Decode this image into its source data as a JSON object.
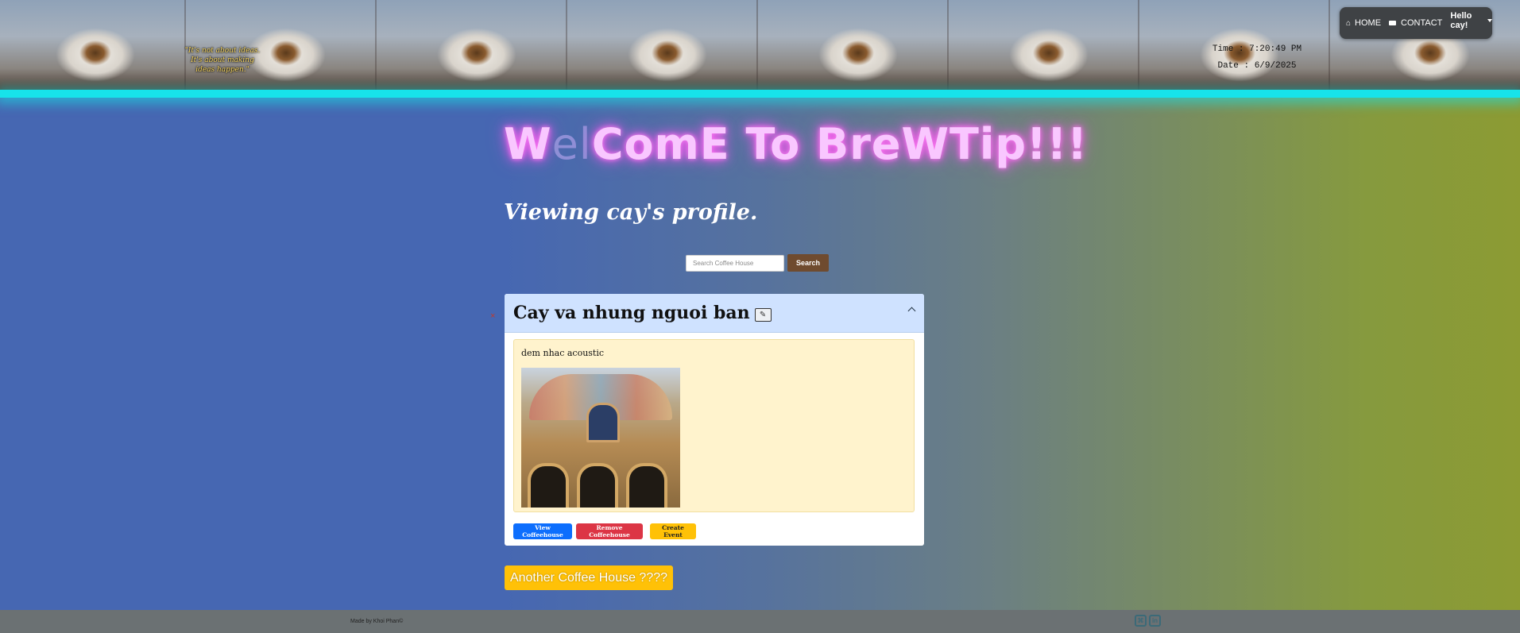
{
  "header": {
    "quote": "\"It's not about ideas. It's about making ideas happen.\"",
    "time_label": "Time : 7:20:49 PM",
    "date_label": "Date : 6/9/2025",
    "nav": {
      "home_icon": "home-icon",
      "home_label": "HOME",
      "contact_icon": "envelope-icon",
      "contact_label": "CONTACT",
      "user_menu_label": "Hello cay!"
    }
  },
  "main": {
    "welcome_heading": {
      "part1": "W",
      "part2_dim": "el",
      "part3": "ComE To BreWTip!!!"
    },
    "profile_heading": "Viewing cay's profile.",
    "search": {
      "placeholder": "Search Coffee House",
      "button_label": "Search"
    },
    "coffeehouse": {
      "remove_marker": "×",
      "name": "Cay va nhung nguoi ban",
      "edit_icon": "pencil-icon",
      "collapse_icon": "chevron-up-icon",
      "event": {
        "name": "dem nhac acoustic",
        "image": "church-facade-photo"
      },
      "buttons": {
        "view": "View Coffeehouse",
        "remove": "Remove Coffeehouse",
        "create_event": "Create Event"
      }
    },
    "another_button": "Another Coffee House ????"
  },
  "footer": {
    "credit": "Made by Khoi Phan©",
    "social_icons": [
      "github-icon",
      "linkedin-icon"
    ]
  },
  "colors": {
    "accent_cyan": "#17e3ea",
    "neon_pink": "#ff57f3",
    "search_brown": "#6f4b2f",
    "primary": "#0d6efd",
    "danger": "#dc3545",
    "warning": "#ffc107"
  }
}
